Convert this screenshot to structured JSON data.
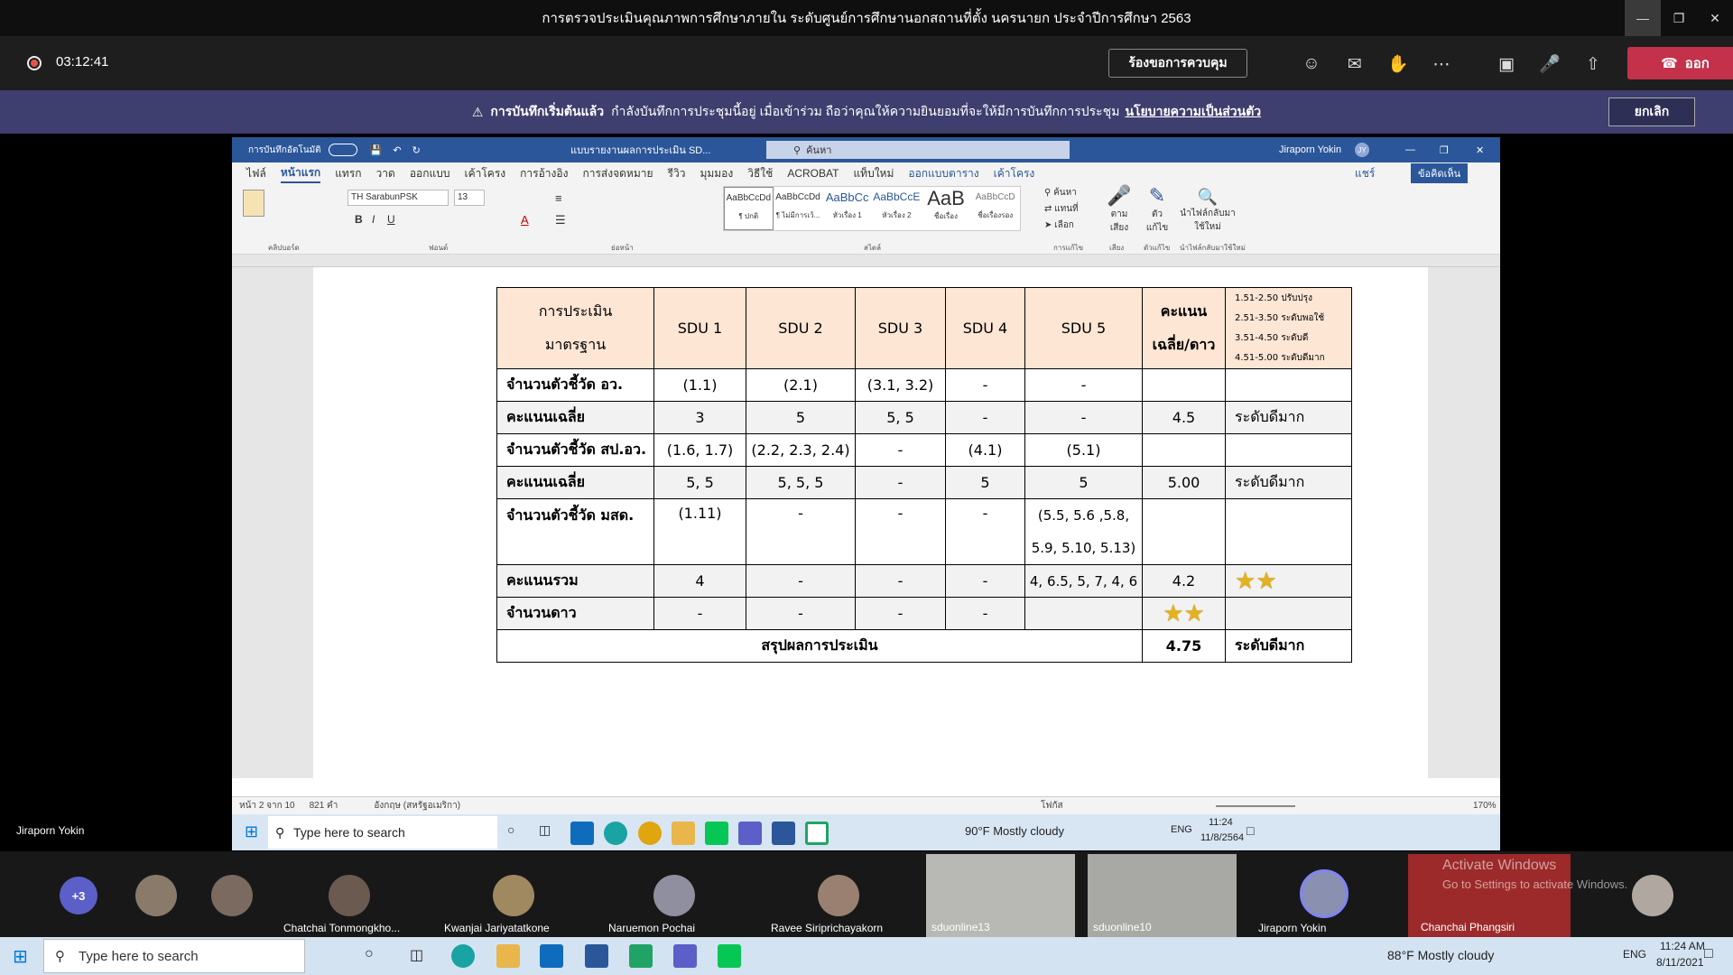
{
  "window": {
    "title": "การตรวจประเมินคุณภาพการศึกษาภายใน ระดับศูนย์การศึกษานอกสถานที่ตั้ง นครนายก ประจำปีการศึกษา 2563",
    "minimize": "—",
    "restore": "❐",
    "close": "✕"
  },
  "meeting": {
    "recording_time": "03:12:41",
    "request_control": "ร้องขอการควบคุม",
    "leave": "ออก",
    "icons": [
      "people-icon",
      "chat-icon",
      "reactions-icon",
      "more-icon",
      "camera-off-icon",
      "mic-off-icon",
      "share-icon"
    ]
  },
  "banner": {
    "bold": "การบันทึกเริ่มต้นแล้ว",
    "text": "กำลังบันทึกการประชุมนี้อยู่ เมื่อเข้าร่วม ถือว่าคุณให้ความยินยอมที่จะให้มีการบันทึกการประชุม",
    "link": "นโยบายความเป็นส่วนตัว",
    "dismiss": "ยกเลิก"
  },
  "presenter": "Jiraporn Yokin",
  "word": {
    "autosave": "การบันทึกอัตโนมัติ",
    "doc_title": "แบบรายงานผลการประเมิน SD...",
    "search": "ค้นหา",
    "user": "Jiraporn Yokin",
    "user_initials": "JY",
    "tabs": [
      "ไฟล์",
      "หน้าแรก",
      "แทรก",
      "วาด",
      "ออกแบบ",
      "เค้าโครง",
      "การอ้างอิง",
      "การส่งจดหมาย",
      "รีวิว",
      "มุมมอง",
      "วิธีใช้",
      "ACROBAT",
      "แท็บใหม่",
      "ออกแบบตาราง",
      "เค้าโครง"
    ],
    "share": "แชร์",
    "comments": "ข้อคิดเห็น",
    "font": "TH SarabunPSK",
    "size": "13",
    "styles": [
      {
        "sample": "AaBbCcDd",
        "name": "¶ ปกติ"
      },
      {
        "sample": "AaBbCcDd",
        "name": "¶ ไม่มีการเว้..."
      },
      {
        "sample": "AaBbCc",
        "name": "หัวเรื่อง 1"
      },
      {
        "sample": "AaBbCcE",
        "name": "หัวเรื่อง 2"
      },
      {
        "sample": "AaB",
        "name": "ชื่อเรื่อง"
      },
      {
        "sample": "AaBbCcD",
        "name": "ชื่อเรื่องรอง"
      }
    ],
    "ribbon_groups": [
      "คลิปบอร์ด",
      "ฟอนต์",
      "ย่อหน้า",
      "สไตล์",
      "การแก้ไข",
      "เสียง",
      "ตัวแก้ไข",
      "นำไฟล์กลับมาใช้ใหม่"
    ],
    "editing": {
      "find": "ค้นหา",
      "replace": "แทนที่",
      "select": "เลือก"
    },
    "voice": "ตามเสียง",
    "editor": "ตัวแก้ไข",
    "reuse": "นำไฟล์กลับมาใช้ใหม่",
    "status": {
      "page": "หน้า 2 จาก 10",
      "words": "821 คำ",
      "lang": "อังกฤษ (สหรัฐอเมริกา)",
      "focus": "โฟกัส",
      "zoom": "170%"
    }
  },
  "table": {
    "head_label_1": "การประเมิน",
    "head_label_2": "มาตรฐาน",
    "columns": [
      "SDU 1",
      "SDU 2",
      "SDU 3",
      "SDU 4",
      "SDU 5"
    ],
    "avg_head_1": "คะแนน",
    "avg_head_2": "เฉลี่ย/ดาว",
    "scale": [
      "1.51-2.50 ปรับปรุง",
      "2.51-3.50 ระดับพอใช้",
      "3.51-4.50 ระดับดี",
      "4.51-5.00 ระดับดีมาก"
    ],
    "rows": [
      {
        "label": "จำนวนตัวชี้วัด อว.",
        "cells": [
          "(1.1)",
          "(2.1)",
          "(3.1, 3.2)",
          "-",
          "-"
        ],
        "avg": "",
        "level": ""
      },
      {
        "label": "คะแนนเฉลี่ย",
        "cells": [
          "3",
          "5",
          "5, 5",
          "-",
          "-"
        ],
        "avg": "4.5",
        "level": "ระดับดีมาก"
      },
      {
        "label": "จำนวนตัวชี้วัด สป.อว.",
        "cells": [
          "(1.6, 1.7)",
          "(2.2, 2.3, 2.4)",
          "-",
          "(4.1)",
          "(5.1)"
        ],
        "avg": "",
        "level": ""
      },
      {
        "label": "คะแนนเฉลี่ย",
        "cells": [
          "5, 5",
          "5, 5, 5",
          "-",
          "5",
          "5"
        ],
        "avg": "5.00",
        "level": "ระดับดีมาก"
      },
      {
        "label": "จำนวนตัวชี้วัด มสด.",
        "cells": [
          "(1.11)",
          "-",
          "-",
          "-",
          "(5.5, 5.6 ,5.8,"
        ],
        "cells2": "5.9, 5.10, 5.13)",
        "avg": "",
        "level": ""
      },
      {
        "label": "คะแนนรวม",
        "cells": [
          "4",
          "-",
          "-",
          "-",
          "4, 6.5, 5, 7, 4, 6"
        ],
        "avg": "4.2",
        "level": ""
      },
      {
        "label": "จำนวนดาว",
        "cells": [
          "-",
          "-",
          "-",
          "-",
          ""
        ],
        "avg": "",
        "level": ""
      }
    ],
    "summary_label": "สรุปผลการประเมิน",
    "summary_avg": "4.75",
    "summary_level": "ระดับดีมาก"
  },
  "inner_taskbar": {
    "search": "Type here to search",
    "weather": "90°F  Mostly cloudy",
    "lang": "ENG",
    "time": "11:24",
    "date": "11/8/2564"
  },
  "participants": [
    {
      "name": "Chatchai Tonmongkho..."
    },
    {
      "name": "Kwanjai Jariyatatkone"
    },
    {
      "name": "Naruemon Pochai"
    },
    {
      "name": "Ravee Siriprichayakorn"
    },
    {
      "name": "sduonline13"
    },
    {
      "name": "sduonline10"
    },
    {
      "name": "Jiraporn Yokin"
    },
    {
      "name": "Chanchai Phangsiri"
    }
  ],
  "overflow_count": "+3",
  "activate": {
    "line1": "Activate Windows",
    "line2": "Go to Settings to activate Windows."
  },
  "taskbar": {
    "search": "Type here to search",
    "weather": "88°F  Mostly cloudy",
    "lang": "ENG",
    "time": "11:24 AM",
    "date": "8/11/2021"
  },
  "colors": {
    "teams_banner": "#3e3f6e",
    "leave": "#c4314b",
    "word_blue": "#2b579a",
    "table_header": "#fde6d4",
    "star": "#e4b21f"
  }
}
